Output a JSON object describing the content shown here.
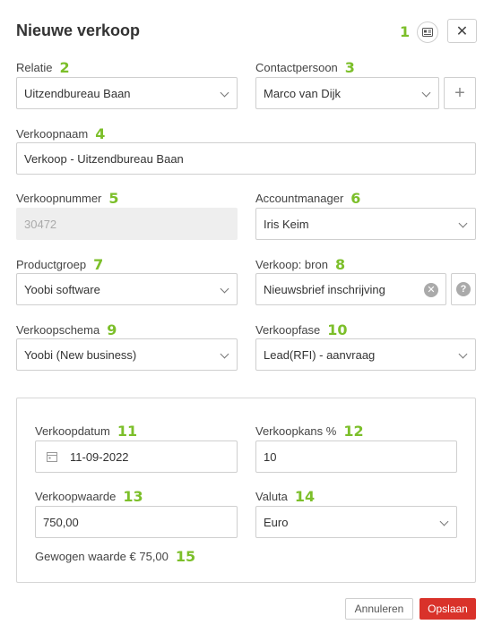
{
  "dialog": {
    "title": "Nieuwe verkoop",
    "close_glyph": "✕"
  },
  "annotations": [
    "1",
    "2",
    "3",
    "4",
    "5",
    "6",
    "7",
    "8",
    "9",
    "10",
    "11",
    "12",
    "13",
    "14",
    "15"
  ],
  "fields": {
    "relatie": {
      "label": "Relatie",
      "value": "Uitzendbureau Baan"
    },
    "contactpersoon": {
      "label": "Contactpersoon",
      "value": "Marco van Dijk"
    },
    "verkoopnaam": {
      "label": "Verkoopnaam",
      "value": "Verkoop - Uitzendbureau Baan"
    },
    "verkoopnummer": {
      "label": "Verkoopnummer",
      "value": "30472"
    },
    "accountmanager": {
      "label": "Accountmanager",
      "value": "Iris Keim"
    },
    "productgroep": {
      "label": "Productgroep",
      "value": "Yoobi software"
    },
    "bron": {
      "label": "Verkoop: bron",
      "value": "Nieuwsbrief inschrijving"
    },
    "verkoopschema": {
      "label": "Verkoopschema",
      "value": "Yoobi (New business)"
    },
    "verkoopfase": {
      "label": "Verkoopfase",
      "value": "Lead(RFI) - aanvraag"
    },
    "verkoopdatum": {
      "label": "Verkoopdatum",
      "value": "11-09-2022"
    },
    "verkoopkans": {
      "label": "Verkoopkans %",
      "value": "10"
    },
    "verkoopwaarde": {
      "label": "Verkoopwaarde",
      "value": "750,00"
    },
    "valuta": {
      "label": "Valuta",
      "value": "Euro"
    }
  },
  "weighted_value": "Gewogen waarde € 75,00",
  "buttons": {
    "cancel": "Annuleren",
    "save": "Opslaan",
    "plus": "+",
    "help": "?"
  },
  "colors": {
    "annotation": "#7cbf2a",
    "primary": "#d9322a"
  },
  "icons": [
    "contact-card-icon",
    "close-icon",
    "chevron-down-icon",
    "plus-icon",
    "clear-icon",
    "help-icon",
    "calendar-icon"
  ]
}
